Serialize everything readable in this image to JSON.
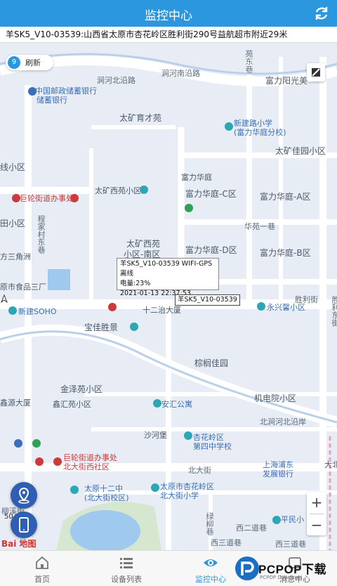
{
  "header": {
    "title": "监控中心",
    "refresh_icon": "refresh-icon"
  },
  "address_bar": {
    "text": "羊SK5_V10-03539:山西省太原市杏花岭区胜利街290号益航超市附近29米"
  },
  "map": {
    "refresh_button": {
      "count": "9",
      "label": "刷新"
    },
    "popup": {
      "line1": "羊SK5_V10-03539 WIFI-GPS 离线",
      "line2": "电量:23%",
      "line3": "2021-01-13 22:37:53"
    },
    "vehicle_label": "羊SK5_V10-03539",
    "labels": {
      "l1": "涧河北沿路",
      "l2": "涧河南沿路",
      "l3": "中国邮政储蓄银行",
      "l3b": "储蓄银行",
      "l4": "苑东巷",
      "l5": "富力阳光美",
      "l6": "太矿育才苑",
      "l7": "新建路小学",
      "l7b": "(富力华庭分校)",
      "l8": "太矿佳园小区",
      "l9": "线小区",
      "l10": "富力华庭",
      "l11": "巨轮街道办事处",
      "l12": "太矿西苑小区",
      "l13": "富力华庭-C区",
      "l14": "富力华庭-A区",
      "l15": "田小区",
      "l16": "华苑一巷",
      "l17": "太矿西苑",
      "l17b": "小区-南区",
      "l18": "富力华庭-D区",
      "l19": "富力华庭-B区",
      "l20": "方三角洲",
      "l21": "原市食品三厂",
      "l22": "新建SOHO",
      "l23": "十二治大厦",
      "l24": "胜利街",
      "l25": "宝佳胜景",
      "l26": "永兴馨小区",
      "l27": "棕榈佳园",
      "l28": "金泽苑小区",
      "l29": "机电院小区",
      "l30": "鑫源大厦",
      "l31": "鑫汇苑小区",
      "l32": "安汇公寓",
      "l33": "北涧河北沿岸",
      "l34": "沙河堡",
      "l35": "杏花岭区",
      "l35b": "第四中学校",
      "l36": "巨轮街道办事处",
      "l36b": "北大街西社区",
      "l37": "北大街",
      "l38": "上海浦东",
      "l38b": "发展银行",
      "l39": "太原十二中",
      "l39b": "(北大街校区)",
      "l40": "太原市杏花岭区",
      "l40b": "北大街小学",
      "l41": "平民小",
      "l42": "西二道巷",
      "l43": "西三道巷",
      "l44": "绿柳巷",
      "l45": "柳溪街",
      "l46": "程家村东巷",
      "l47": "胜利东街",
      "l48": "大北"
    },
    "zoom_in": "+",
    "zoom_out": "−",
    "scale": "50",
    "logo": "Bai 地图"
  },
  "tabs": [
    {
      "label": "首页",
      "icon": "home-icon",
      "active": false
    },
    {
      "label": "设备列表",
      "icon": "list-icon",
      "active": false
    },
    {
      "label": "监控中心",
      "icon": "eye-icon",
      "active": true
    },
    {
      "label": "消息中心",
      "icon": "message-icon",
      "active": false
    }
  ],
  "watermark": {
    "text": "PCPOP下载",
    "sub": "PCPOP Download"
  },
  "colors": {
    "primary": "#2b97de",
    "fab": "#2f5fb3",
    "poi_red": "#cc3b3b"
  }
}
